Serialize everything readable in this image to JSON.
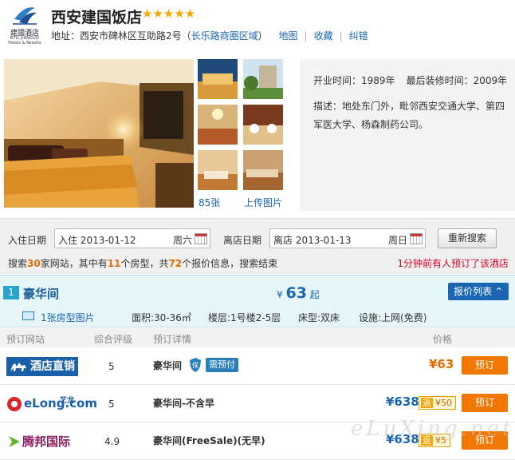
{
  "logo": {
    "cn": "建國酒店",
    "en": "BTG-JIANGUO",
    "en2": "Hotels & Resorts"
  },
  "hotel": {
    "name": "西安建国饭店",
    "stars": "★★★★★"
  },
  "address": {
    "prefix": "地址：西安市碑林区互助路2号（",
    "area_link": "长乐路商圈区域",
    "suffix": "）",
    "map": "地图",
    "fav": "收藏",
    "correct": "纠错"
  },
  "photos": {
    "count": "85张",
    "upload": "上传图片"
  },
  "info": {
    "open_label": "开业时间：",
    "open_year": "1989年",
    "renov_label": "最后装修时间：",
    "renov_year": "2009年",
    "desc": "描述：地处东门外，毗邻西安交通大学、第四军医大学、杨森制药公司。"
  },
  "search": {
    "checkin_label": "入住日期",
    "checkin_value": "入住 2013-01-12",
    "checkin_weekday": "周六",
    "checkout_label": "离店日期",
    "checkout_value": "离店 2013-01-13",
    "checkout_weekday": "周日",
    "button": "重新搜索",
    "sum_1": "搜索",
    "sum_sites": "30",
    "sum_2": "家网站，其中有",
    "sum_rooms": "11",
    "sum_3": "个房型，共",
    "sum_offers": "72",
    "sum_4": "个报价信息，搜索结束",
    "recent": "1分钟前有人预订了该酒店"
  },
  "room": {
    "num": "1",
    "name": "豪华间",
    "price_prefix": "¥",
    "price": "63",
    "price_suffix": "起",
    "list_button": "报价列表 ⌃",
    "pics": "1张房型图片",
    "area": "面积:30-36㎡",
    "floor": "楼层:1号楼2-5层",
    "bed": "床型:双床",
    "facility": "设施:上网(免费)"
  },
  "table": {
    "headers": {
      "site": "预订网站",
      "rating": "综合评级",
      "detail": "预订详情",
      "price": "价格"
    },
    "rows": [
      {
        "site": "酒店直销",
        "rating": "5",
        "name": "豪华间",
        "tag": "需预付",
        "price": "¥63",
        "fan": "",
        "book": "预订"
      },
      {
        "site": "eLong.com",
        "site_sub": "艺龙",
        "rating": "5",
        "name": "豪华间-不含早",
        "price": "¥638",
        "fan": "¥50",
        "fan_icon": "返",
        "book": "预订"
      },
      {
        "site": "腾邦国际",
        "rating": "4.9",
        "name": "豪华间(FreeSale)(无早)",
        "price": "¥638",
        "fan": "¥5",
        "fan_icon": "返",
        "book": "预订"
      }
    ]
  },
  "watermark": "eLuXing.net",
  "colors": {
    "accent": "#1a66b3",
    "orange": "#f07800",
    "price_orange": "#e66a00",
    "room_bg": "#e5f5f8"
  }
}
